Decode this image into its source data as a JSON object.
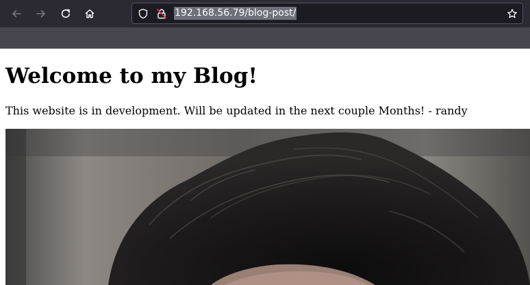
{
  "browser": {
    "url": "192.168.56.79/blog-post/",
    "icons": {
      "back": "arrow-left-icon",
      "forward": "arrow-right-icon",
      "reload": "reload-icon",
      "home": "home-icon",
      "tracking": "shield-icon",
      "connection": "insecure-lock-icon",
      "bookmark": "star-icon"
    },
    "colors": {
      "toolbar": "#2b2a33",
      "urlbar": "#1c1b22",
      "url_selection": "#6f7079",
      "lock_slash": "#e22850"
    }
  },
  "page": {
    "title": "Welcome to my Blog!",
    "intro": "This website is in development. Will be updated in the next couple Months! - randy"
  }
}
